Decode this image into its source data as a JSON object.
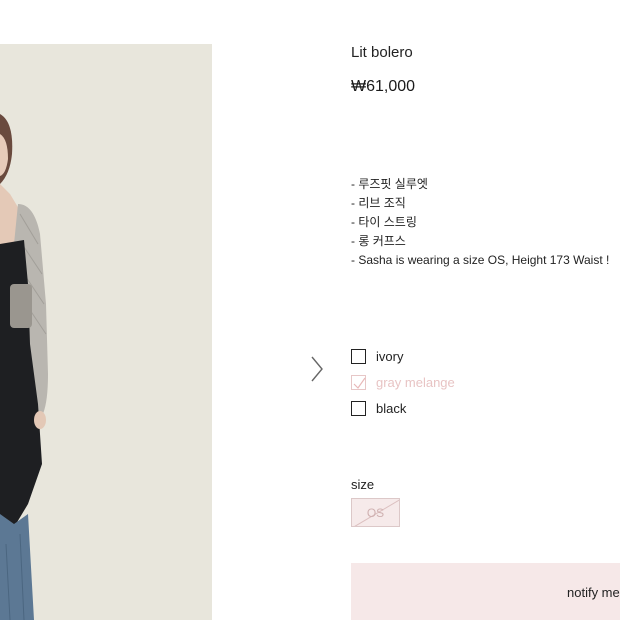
{
  "product": {
    "title": "Lit bolero",
    "price": "₩61,000",
    "description": [
      "- 루즈핏 실루엣",
      "- 리브 조직",
      "- 타이 스트링",
      "- 롱 커프스",
      "- Sasha is wearing a size OS, Height 173 Waist !"
    ]
  },
  "colors": {
    "options": [
      {
        "label": "ivory",
        "selected": false,
        "disabled": false
      },
      {
        "label": "gray melange",
        "selected": false,
        "disabled": true
      },
      {
        "label": "black",
        "selected": false,
        "disabled": false
      }
    ]
  },
  "size": {
    "label": "size",
    "options": [
      {
        "label": "OS",
        "disabled": true
      }
    ]
  },
  "actions": {
    "notify_label": "notify me"
  },
  "gallery": {
    "next_icon": "chevron-right-icon",
    "image_alt": "model wearing gray bolero over black top and jeans"
  },
  "theme": {
    "disabled_color": "#e8c4c4",
    "notify_bg": "#f6e8e8",
    "photo_bg": "#e8e6dc"
  }
}
